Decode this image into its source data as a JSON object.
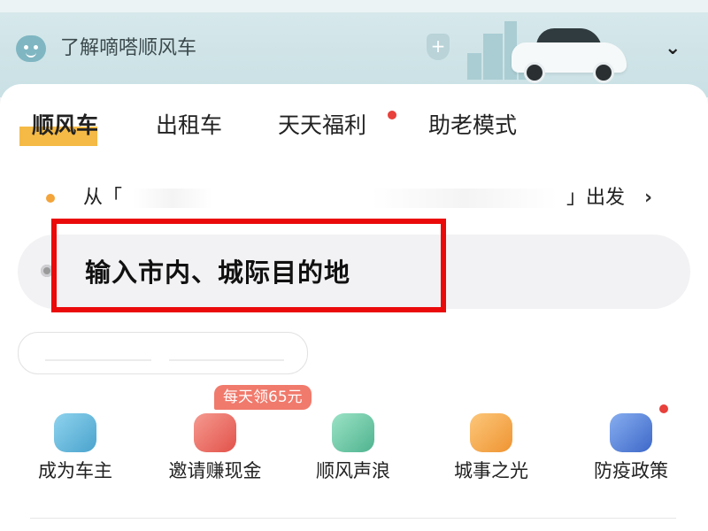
{
  "banner": {
    "title": "了解嘀嗒顺风车",
    "bot_icon": "smiley-bot-icon",
    "shield_icon": "shield-plus-icon",
    "shield_symbol": "+",
    "chevron": "⌄"
  },
  "tabs": [
    {
      "label": "顺风车",
      "active": true
    },
    {
      "label": "出租车",
      "active": false
    },
    {
      "label": "天天福利",
      "active": false,
      "has_dot": true
    },
    {
      "label": "助老模式",
      "active": false
    }
  ],
  "trip": {
    "from_prefix": "从「",
    "from_suffix": "」出发",
    "arrow": "›",
    "destination_placeholder": "输入市内、城际目的地"
  },
  "promo_badge": "每天领65元",
  "services": [
    {
      "label": "成为车主",
      "icon": "steering-blue-icon",
      "color": "#5fb4d6"
    },
    {
      "label": "邀请赚现金",
      "icon": "red-envelope-icon",
      "color": "#ec6b63"
    },
    {
      "label": "顺风声浪",
      "icon": "voice-wave-icon",
      "color": "#66c2a4"
    },
    {
      "label": "城事之光",
      "icon": "city-light-icon",
      "color": "#f3a443"
    },
    {
      "label": "防疫政策",
      "icon": "gear-policy-icon",
      "color": "#4f7fd8",
      "has_dot": true
    }
  ],
  "colors": {
    "accent": "#f5ba46",
    "highlight": "#ea0a0a",
    "red_dot": "#e8403b"
  }
}
